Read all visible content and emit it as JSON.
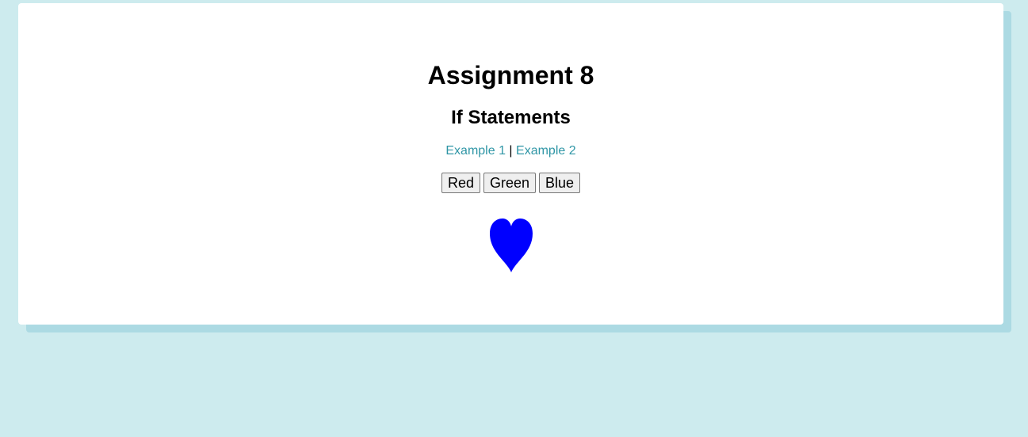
{
  "page": {
    "title": "Assignment 8",
    "subtitle": "If Statements"
  },
  "links": {
    "example1": "Example 1",
    "separator": " | ",
    "example2": "Example 2"
  },
  "buttons": {
    "red": "Red",
    "green": "Green",
    "blue": "Blue"
  },
  "heart": {
    "icon": "heart-icon",
    "color": "#0000ff"
  },
  "colors": {
    "background": "#cdebee",
    "card": "#ffffff",
    "card_shadow": "#acdae3",
    "link": "#2f96a6"
  }
}
